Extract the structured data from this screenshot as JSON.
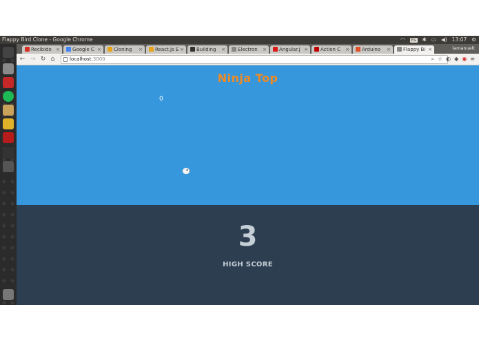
{
  "window": {
    "title": "Flappy Bird Clone - Google Chrome",
    "keyboard_layout": "Es",
    "clock": "13:07",
    "profile_name": "lamanuelt"
  },
  "tabs": [
    {
      "label": "Recibido",
      "icon": "gmail-icon",
      "color": "#d93025"
    },
    {
      "label": "Google C",
      "icon": "google-icon",
      "color": "#4285f4"
    },
    {
      "label": "Cloning",
      "icon": "doc-icon",
      "color": "#e8a317"
    },
    {
      "label": "React.Js E",
      "icon": "doc-icon",
      "color": "#e8a317"
    },
    {
      "label": "Building",
      "icon": "page-icon",
      "color": "#333333"
    },
    {
      "label": "Electron",
      "icon": "page-icon",
      "color": "#888888"
    },
    {
      "label": "Angular.J",
      "icon": "angular-icon",
      "color": "#dd1b16"
    },
    {
      "label": "Action C",
      "icon": "action-icon",
      "color": "#c00000"
    },
    {
      "label": "Arduino",
      "icon": "arduino-icon",
      "color": "#e34f26"
    },
    {
      "label": "Flappy Bi",
      "icon": "page-icon",
      "color": "#888888",
      "active": true
    }
  ],
  "address_bar": {
    "host": "localhost",
    "port": ":3000"
  },
  "game": {
    "title": "Ninja Top",
    "score": "0",
    "high_score_value": "3",
    "high_score_label": "HIGH SCORE",
    "sky_color": "#3697dc",
    "ground_color": "#2d3e50",
    "title_color": "#f08a24"
  },
  "launcher": [
    {
      "name": "dash-icon",
      "color": "#444444"
    },
    {
      "name": "files-icon",
      "color": "#8a8a8a"
    },
    {
      "name": "pdf-icon",
      "color": "#c62828"
    },
    {
      "name": "spotify-icon",
      "color": "#1db954"
    },
    {
      "name": "folder-icon",
      "color": "#c9a35a"
    },
    {
      "name": "chrome-icon",
      "color": "#e0b22a"
    },
    {
      "name": "filezilla-icon",
      "color": "#b71c1c"
    },
    {
      "name": "terminal-icon",
      "color": "#333333"
    },
    {
      "name": "sublime-icon",
      "color": "#555555"
    },
    {
      "name": "trash-icon",
      "color": "#777777"
    }
  ]
}
